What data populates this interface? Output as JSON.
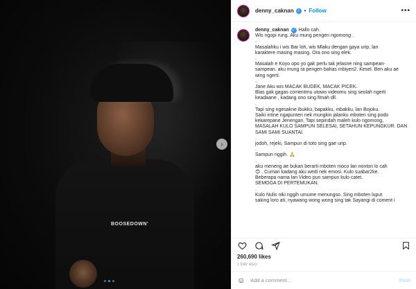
{
  "post": {
    "username": "denny_caknan",
    "follow_label": "Follow",
    "separator": "•",
    "more_label": "•••",
    "shirt_text": "BOOSEDOWN'",
    "carousel": {
      "total": 3,
      "active_index": 1
    },
    "caption_lines": [
      "Hallo cah.",
      "Wis ngopi rung. Aku mung pengen ngomong .",
      ".",
      "Masalahku i wis Bar loh, wis Mlaku dengan gaya urip, lan",
      "karaktere masing masing. Ora ono sing elek.",
      ".",
      "Masalah e Koyo opo yo gak perlu tak jelasne ning sampean-",
      "sampean. aku mung ra pengen bahas mbiyen2. Kesel. Ben aku ae",
      "wing ngerti.",
      "..",
      "Jane Aku wis MACAK BUDEK, MACAK PICEK.",
      "Blas gak gagas comentmu utowo videomu sing seolah ngerti",
      "keadaane , kadang ono sing fitnah dll.",
      ".",
      "Tapi sing ngesakne ibukku, bapakku, mbakku, lan Bojoku.",
      "Saiki intine ngapunten nek mungkin jalanku mboten sing podo",
      "kekarepane Jenengan, Tapi sepindah maleh kulo ngomong,",
      "MASALAH KULO SAMPUN SELESAI, SETAHUN KEPUNGKUR. DAN",
      "SAMI SAMI SUANTAI.",
      ".",
      "jodoh, rejeki, Sampun di toto sing gae urip.",
      ".",
      "Sampun nggih. 🙏",
      ".",
      "aku meneng ae bukan berarti mboten moco lan nonton lo cah",
      "😊 . Cuman kadang aku wedi nek emosi. Kulo suabar2ke.",
      "Beberapa nama lan Video pun sampun kulo catet.",
      "SEMOGA DI PERTEMUKAN.",
      ".",
      "Kulo Nulis niki nggih umume menungso. Sing mboten luput",
      "saking loro ati, nyawang wong wong sing tak Sayangi di coment i"
    ],
    "likes": "260,690 likes",
    "date": "1 DAY AGO",
    "comment_placeholder": "Add a comment…",
    "post_label": "Post",
    "colors": {
      "follow": "#0095f6",
      "verified": "#3897f0",
      "post_disabled": "#b2dffc",
      "avatar_ring": "#d6249f"
    },
    "icons": {
      "like": "heart-icon",
      "comment": "comment-icon",
      "share": "share-icon",
      "save": "bookmark-icon",
      "emoji": "smiley-icon",
      "next": "chevron-right-icon",
      "verified": "verified-badge-icon",
      "more": "more-options-icon"
    }
  }
}
